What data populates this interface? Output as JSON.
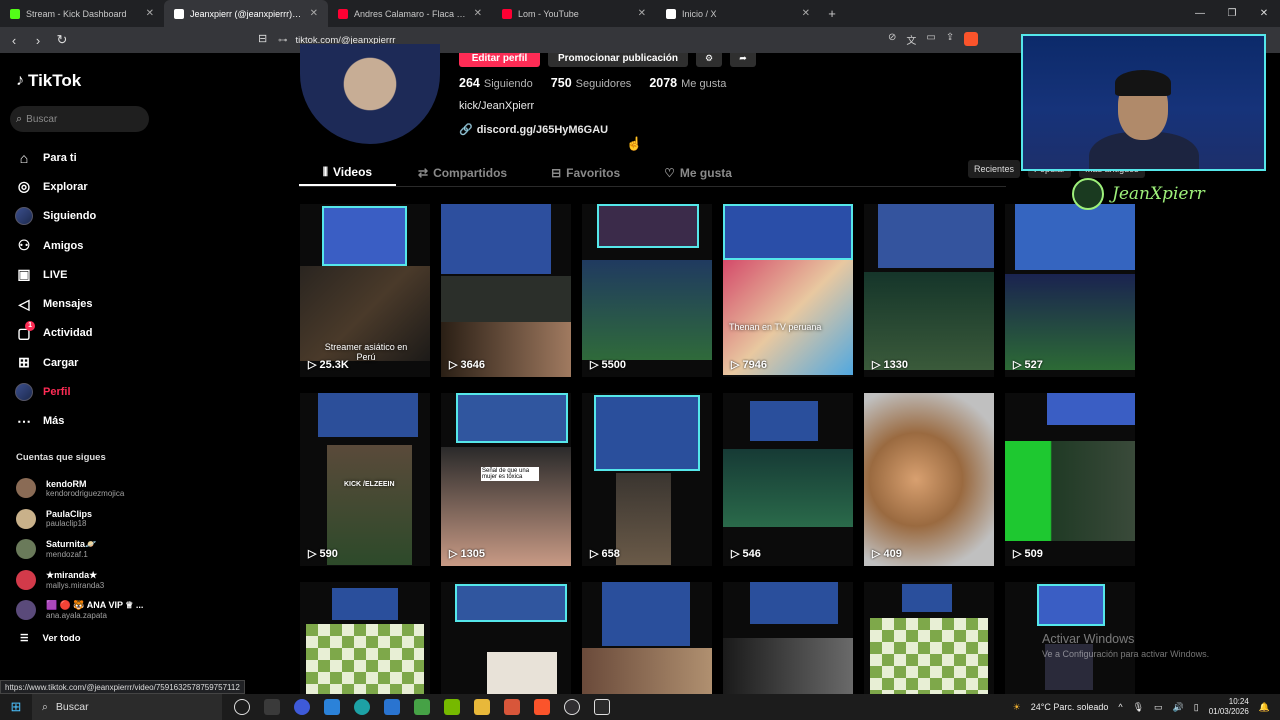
{
  "browser": {
    "tabs": [
      {
        "label": "Stream - Kick Dashboard",
        "color": "#53fc18"
      },
      {
        "label": "Jeanxpierr (@jeanxpierrr) | TikTok",
        "color": "#ffffff"
      },
      {
        "label": "Andres Calamaro - Flaca (Video clip)",
        "color": "#ff0033"
      },
      {
        "label": "Lom - YouTube",
        "color": "#ff0033"
      },
      {
        "label": "Inicio / X",
        "color": "#ffffff"
      }
    ],
    "url": "tiktok.com/@jeanxpierrr",
    "status_url": "https://www.tiktok.com/@jeanxpierrr/video/7591632578759757112"
  },
  "sidebar": {
    "logo": "TikTok",
    "search_placeholder": "Buscar",
    "nav": [
      {
        "label": "Para ti",
        "icon": "home-icon"
      },
      {
        "label": "Explorar",
        "icon": "compass-icon"
      },
      {
        "label": "Siguiendo",
        "icon": "following-avatar-icon"
      },
      {
        "label": "Amigos",
        "icon": "friends-icon"
      },
      {
        "label": "LIVE",
        "icon": "live-icon"
      },
      {
        "label": "Mensajes",
        "icon": "messages-icon"
      },
      {
        "label": "Actividad",
        "icon": "activity-icon",
        "badge": "1"
      },
      {
        "label": "Cargar",
        "icon": "upload-icon"
      },
      {
        "label": "Perfil",
        "icon": "profile-avatar-icon"
      },
      {
        "label": "Más",
        "icon": "more-icon"
      }
    ],
    "follows_title": "Cuentas que sigues",
    "follows": [
      {
        "name": "kendoRM",
        "handle": "kendorodriguezmojica",
        "color": "#8a6b55"
      },
      {
        "name": "PaulaClips",
        "handle": "paulaclip18",
        "color": "#c9b18a"
      },
      {
        "name": "Saturnita🪐",
        "handle": "mendozaf.1",
        "color": "#6a7a5a"
      },
      {
        "name": "★miranda★",
        "handle": "mallys.miranda3",
        "color": "#d23a4a"
      },
      {
        "name": "🟪 🔴 🐯 ANA VIP ♕ ...",
        "handle": "ana.ayala.zapata",
        "color": "#5a4a7a"
      }
    ],
    "see_all": "Ver todo"
  },
  "profile": {
    "edit_button": "Editar perfil",
    "promo_button": "Promocionar publicación",
    "stats": [
      {
        "value": "264",
        "label": "Siguiendo"
      },
      {
        "value": "750",
        "label": "Seguidores"
      },
      {
        "value": "2078",
        "label": "Me gusta"
      }
    ],
    "bio": "kick/JeanXpierr",
    "link": "discord.gg/J65HyM6GAU",
    "tabs": [
      {
        "label": "Videos",
        "icon": "grid-icon"
      },
      {
        "label": "Compartidos",
        "icon": "repost-icon"
      },
      {
        "label": "Favoritos",
        "icon": "bookmark-icon"
      },
      {
        "label": "Me gusta",
        "icon": "heart-icon"
      }
    ],
    "sort": [
      "Recientes",
      "Popular",
      "Más antiguos"
    ]
  },
  "videos": [
    {
      "views": "25.3K",
      "caption": "Streamer asiático en Perú"
    },
    {
      "views": "3646",
      "caption": ""
    },
    {
      "views": "5500",
      "caption": ""
    },
    {
      "views": "7946",
      "caption": "Thenan en TV peruana"
    },
    {
      "views": "1330",
      "caption": ""
    },
    {
      "views": "527",
      "caption": ""
    },
    {
      "views": "590",
      "caption": "KICK /ELZEEIN"
    },
    {
      "views": "1305",
      "caption": "Señal de que una mujer es tóxica"
    },
    {
      "views": "658",
      "caption": ""
    },
    {
      "views": "546",
      "caption": ""
    },
    {
      "views": "409",
      "caption": ""
    },
    {
      "views": "509",
      "caption": ""
    },
    {
      "views": "",
      "caption": ""
    },
    {
      "views": "",
      "caption": ""
    },
    {
      "views": "",
      "caption": ""
    },
    {
      "views": "",
      "caption": ""
    },
    {
      "views": "",
      "caption": ""
    },
    {
      "views": "",
      "caption": ""
    }
  ],
  "overlay": {
    "streamer_name": "JeanXpierr",
    "watermark_title": "Activar Windows",
    "watermark_sub": "Ve a Configuración para activar Windows."
  },
  "taskbar": {
    "search": "Buscar",
    "weather": "24°C  Parc. soleado",
    "time": "10:24",
    "date": "01/03/2026"
  },
  "colors": {
    "accent": "#fe2c55",
    "webcam_border": "#55e7ea",
    "name_green": "#9ef07a"
  }
}
